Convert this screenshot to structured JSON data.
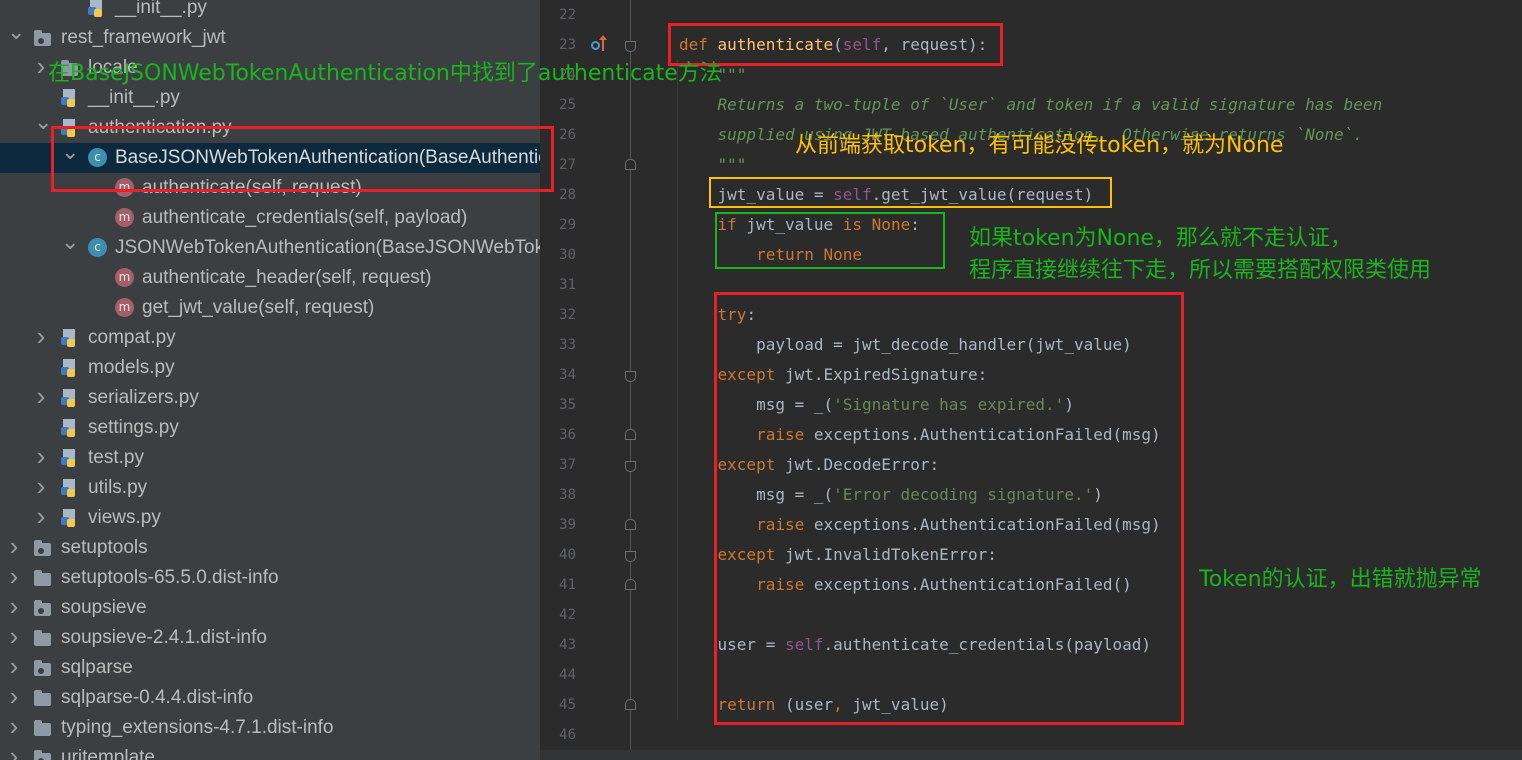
{
  "tree": {
    "items": [
      {
        "id": "init-top",
        "label": "__init__.py",
        "indent": 2,
        "arrow": "",
        "icon": "python-file-icon"
      },
      {
        "id": "rest-framework-jwt",
        "label": "rest_framework_jwt",
        "indent": 0,
        "arrow": "down",
        "icon": "package-folder-icon"
      },
      {
        "id": "locale",
        "label": "locale",
        "indent": 1,
        "arrow": "right",
        "icon": "folder-icon"
      },
      {
        "id": "init-py",
        "label": "__init__.py",
        "indent": 1,
        "arrow": "",
        "icon": "python-file-icon"
      },
      {
        "id": "authentication-py",
        "label": "authentication.py",
        "indent": 1,
        "arrow": "down",
        "icon": "python-file-icon"
      },
      {
        "id": "base-jwt-auth-class",
        "label": "BaseJSONWebTokenAuthentication(BaseAuthentication)",
        "indent": 2,
        "arrow": "down",
        "icon": "class-icon",
        "selected": true
      },
      {
        "id": "authenticate-method",
        "label": "authenticate(self, request)",
        "indent": 3,
        "arrow": "",
        "icon": "method-icon"
      },
      {
        "id": "authenticate-credentials-method",
        "label": "authenticate_credentials(self, payload)",
        "indent": 3,
        "arrow": "",
        "icon": "method-icon"
      },
      {
        "id": "jwt-auth-class",
        "label": "JSONWebTokenAuthentication(BaseJSONWebTokenAuthentication)",
        "indent": 2,
        "arrow": "down",
        "icon": "class-icon"
      },
      {
        "id": "authenticate-header-method",
        "label": "authenticate_header(self, request)",
        "indent": 3,
        "arrow": "",
        "icon": "method-icon"
      },
      {
        "id": "get-jwt-value-method",
        "label": "get_jwt_value(self, request)",
        "indent": 3,
        "arrow": "",
        "icon": "method-icon"
      },
      {
        "id": "compat-py",
        "label": "compat.py",
        "indent": 1,
        "arrow": "right",
        "icon": "python-file-icon"
      },
      {
        "id": "models-py",
        "label": "models.py",
        "indent": 1,
        "arrow": "",
        "icon": "python-file-icon"
      },
      {
        "id": "serializers-py",
        "label": "serializers.py",
        "indent": 1,
        "arrow": "right",
        "icon": "python-file-icon"
      },
      {
        "id": "settings-py",
        "label": "settings.py",
        "indent": 1,
        "arrow": "",
        "icon": "python-file-icon"
      },
      {
        "id": "test-py",
        "label": "test.py",
        "indent": 1,
        "arrow": "right",
        "icon": "python-file-icon"
      },
      {
        "id": "utils-py",
        "label": "utils.py",
        "indent": 1,
        "arrow": "right",
        "icon": "python-file-icon"
      },
      {
        "id": "views-py",
        "label": "views.py",
        "indent": 1,
        "arrow": "right",
        "icon": "python-file-icon"
      },
      {
        "id": "setuptools",
        "label": "setuptools",
        "indent": 0,
        "arrow": "right",
        "icon": "package-folder-icon"
      },
      {
        "id": "setuptools-dist-info",
        "label": "setuptools-65.5.0.dist-info",
        "indent": 0,
        "arrow": "right",
        "icon": "folder-icon"
      },
      {
        "id": "soupsieve",
        "label": "soupsieve",
        "indent": 0,
        "arrow": "right",
        "icon": "package-folder-icon"
      },
      {
        "id": "soupsieve-dist-info",
        "label": "soupsieve-2.4.1.dist-info",
        "indent": 0,
        "arrow": "right",
        "icon": "folder-icon"
      },
      {
        "id": "sqlparse",
        "label": "sqlparse",
        "indent": 0,
        "arrow": "right",
        "icon": "package-folder-icon"
      },
      {
        "id": "sqlparse-dist-info",
        "label": "sqlparse-0.4.4.dist-info",
        "indent": 0,
        "arrow": "right",
        "icon": "folder-icon"
      },
      {
        "id": "typing-extensions-dist-info",
        "label": "typing_extensions-4.7.1.dist-info",
        "indent": 0,
        "arrow": "right",
        "icon": "folder-icon"
      },
      {
        "id": "uritemplate",
        "label": "uritemplate",
        "indent": 0,
        "arrow": "right",
        "icon": "package-folder-icon"
      }
    ]
  },
  "editor": {
    "lines": [
      {
        "num": "22",
        "tokens": []
      },
      {
        "num": "23",
        "marker": "override",
        "fold": "open",
        "tokens": [
          {
            "t": "def ",
            "c": "kw"
          },
          {
            "t": "authenticate",
            "c": "fn"
          },
          {
            "t": "("
          },
          {
            "t": "self",
            "c": "selfkw"
          },
          {
            "t": ", request):"
          }
        ]
      },
      {
        "num": "24",
        "tokens": [
          {
            "t": "    \"\"\"",
            "c": "doc"
          }
        ]
      },
      {
        "num": "25",
        "tokens": [
          {
            "t": "    Returns a two-tuple of `User` and token if a valid signature has been",
            "c": "doc"
          }
        ]
      },
      {
        "num": "26",
        "tokens": [
          {
            "t": "    supplied using JWT-based authentication.  Otherwise returns `None`.",
            "c": "doc"
          }
        ]
      },
      {
        "num": "27",
        "fold": "close",
        "tokens": [
          {
            "t": "    \"\"\"",
            "c": "doc"
          }
        ]
      },
      {
        "num": "28",
        "tokens": [
          {
            "t": "    jwt_value = "
          },
          {
            "t": "self",
            "c": "selfkw"
          },
          {
            "t": ".get_jwt_value(request)"
          }
        ]
      },
      {
        "num": "29",
        "tokens": [
          {
            "t": "    "
          },
          {
            "t": "if",
            "c": "kw"
          },
          {
            "t": " jwt_value "
          },
          {
            "t": "is",
            "c": "kw"
          },
          {
            "t": " "
          },
          {
            "t": "None",
            "c": "kw"
          },
          {
            "t": ":"
          }
        ]
      },
      {
        "num": "30",
        "tokens": [
          {
            "t": "        "
          },
          {
            "t": "return",
            "c": "kw"
          },
          {
            "t": " "
          },
          {
            "t": "None",
            "c": "kw"
          }
        ]
      },
      {
        "num": "31",
        "tokens": []
      },
      {
        "num": "32",
        "tokens": [
          {
            "t": "    "
          },
          {
            "t": "try",
            "c": "kw"
          },
          {
            "t": ":"
          }
        ]
      },
      {
        "num": "33",
        "tokens": [
          {
            "t": "        payload = jwt_decode_handler(jwt_value)"
          }
        ]
      },
      {
        "num": "34",
        "fold": "open",
        "tokens": [
          {
            "t": "    "
          },
          {
            "t": "except",
            "c": "kw"
          },
          {
            "t": " jwt.ExpiredSignature:"
          }
        ]
      },
      {
        "num": "35",
        "tokens": [
          {
            "t": "        msg = _("
          },
          {
            "t": "'Signature has expired.'",
            "c": "str"
          },
          {
            "t": ")"
          }
        ]
      },
      {
        "num": "36",
        "fold": "close",
        "tokens": [
          {
            "t": "        "
          },
          {
            "t": "raise",
            "c": "kw"
          },
          {
            "t": " exceptions.AuthenticationFailed(msg)"
          }
        ]
      },
      {
        "num": "37",
        "fold": "open",
        "tokens": [
          {
            "t": "    "
          },
          {
            "t": "except",
            "c": "kw"
          },
          {
            "t": " jwt.DecodeError:"
          }
        ]
      },
      {
        "num": "38",
        "tokens": [
          {
            "t": "        msg = _("
          },
          {
            "t": "'Error decoding signature.'",
            "c": "str"
          },
          {
            "t": ")"
          }
        ]
      },
      {
        "num": "39",
        "fold": "close",
        "tokens": [
          {
            "t": "        "
          },
          {
            "t": "raise",
            "c": "kw"
          },
          {
            "t": " exceptions.AuthenticationFailed(msg)"
          }
        ]
      },
      {
        "num": "40",
        "fold": "open",
        "tokens": [
          {
            "t": "    "
          },
          {
            "t": "except",
            "c": "kw"
          },
          {
            "t": " jwt.InvalidTokenError:"
          }
        ]
      },
      {
        "num": "41",
        "fold": "close",
        "tokens": [
          {
            "t": "        "
          },
          {
            "t": "raise",
            "c": "kw"
          },
          {
            "t": " exceptions.AuthenticationFailed()"
          }
        ]
      },
      {
        "num": "42",
        "tokens": []
      },
      {
        "num": "43",
        "tokens": [
          {
            "t": "    user = "
          },
          {
            "t": "self",
            "c": "selfkw"
          },
          {
            "t": ".authenticate_credentials(payload)"
          }
        ]
      },
      {
        "num": "44",
        "tokens": []
      },
      {
        "num": "45",
        "fold": "close",
        "tokens": [
          {
            "t": "    "
          },
          {
            "t": "return",
            "c": "kw"
          },
          {
            "t": " (user"
          },
          {
            "t": ",",
            "c": "kw"
          },
          {
            "t": " jwt_value)"
          }
        ]
      },
      {
        "num": "46",
        "tokens": []
      }
    ]
  },
  "annotations": {
    "find_authenticate": "在BaseJSONWebTokenAuthentication中找到了authenticate方法",
    "get_token": "从前端获取token，有可能没传token，就为None",
    "token_none_line1": "如果token为None，那么就不走认证，",
    "token_none_line2": "程序直接继续往下走，所以需要搭配权限类使用",
    "token_verify": "Token的认证，出错就抛异常"
  },
  "colors": {
    "red_box": "#e8202a",
    "yellow": "#ffc000",
    "green": "#19b51b"
  }
}
